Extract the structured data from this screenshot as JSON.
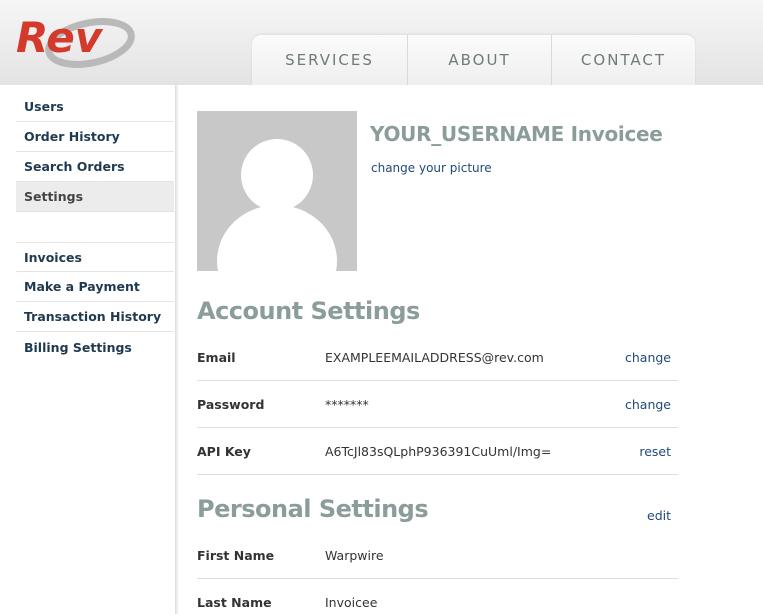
{
  "logo": {
    "text": "Rev"
  },
  "nav": [
    {
      "label": "SERVICES"
    },
    {
      "label": "ABOUT"
    },
    {
      "label": "CONTACT"
    }
  ],
  "sidebar": {
    "group1": [
      {
        "label": "Users"
      },
      {
        "label": "Order History"
      },
      {
        "label": "Search Orders"
      },
      {
        "label": "Settings",
        "active": true
      }
    ],
    "group2": [
      {
        "label": "Invoices"
      },
      {
        "label": "Make a Payment"
      },
      {
        "label": "Transaction History"
      },
      {
        "label": "Billing Settings"
      }
    ]
  },
  "profile": {
    "username": "YOUR_USERNAME Invoicee",
    "change_picture": "change your picture"
  },
  "account_settings": {
    "title": "Account Settings",
    "rows": [
      {
        "label": "Email",
        "value": "EXAMPLEEMAILADDRESS@rev.com",
        "action": "change"
      },
      {
        "label": "Password",
        "value": "*******",
        "action": "change"
      },
      {
        "label": "API Key",
        "value": "A6TcJl83sQLphP936391CuUml/Img=",
        "action": "reset"
      }
    ]
  },
  "personal_settings": {
    "title": "Personal Settings",
    "action": "edit",
    "rows": [
      {
        "label": "First Name",
        "value": "Warpwire"
      },
      {
        "label": "Last Name",
        "value": "Invoicee"
      }
    ]
  },
  "colors": {
    "brand_red": "#d33a2c",
    "heading_gray": "#8b9d9b",
    "link_blue": "#1f4a7a",
    "nav_text": "#6f7a79"
  },
  "icons": [
    "avatar-placeholder-icon"
  ]
}
